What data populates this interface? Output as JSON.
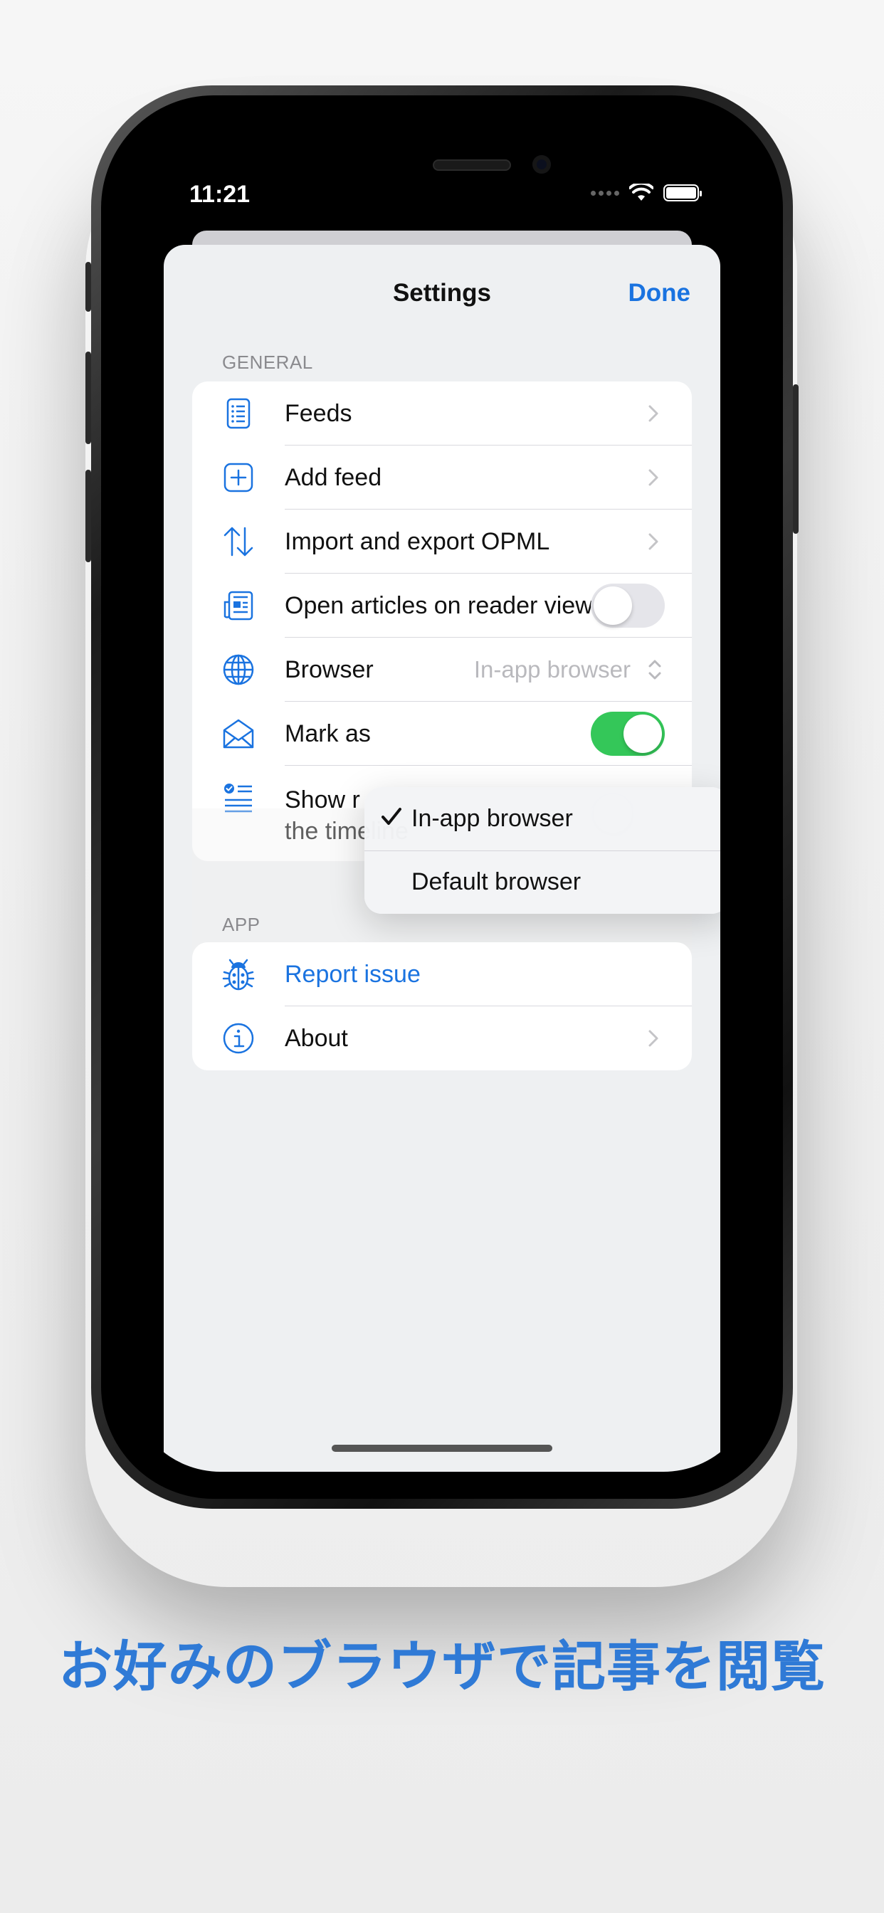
{
  "status_bar": {
    "time": "11:21"
  },
  "nav": {
    "title": "Settings",
    "done_label": "Done"
  },
  "general": {
    "header": "GENERAL",
    "rows": [
      {
        "label": "Feeds",
        "icon": "list-icon",
        "accessory": "chevron"
      },
      {
        "label": "Add feed",
        "icon": "plus-square-icon",
        "accessory": "chevron"
      },
      {
        "label": "Import and export OPML",
        "icon": "arrows-up-down-icon",
        "accessory": "chevron"
      },
      {
        "label": "Open articles on reader view",
        "icon": "newspaper-icon",
        "accessory": "toggle",
        "toggle_on": false
      },
      {
        "label": "Browser",
        "icon": "globe-icon",
        "accessory": "menu",
        "value": "In-app browser"
      },
      {
        "label": "Mark as",
        "icon": "envelope-open-icon",
        "accessory": "toggle",
        "toggle_on": true
      },
      {
        "label": "Show r",
        "label_line2": "the timeline",
        "icon": "checklist-icon",
        "accessory": "toggle",
        "toggle_on": false
      }
    ]
  },
  "browser_menu": {
    "options": [
      {
        "label": "In-app browser",
        "selected": true
      },
      {
        "label": "Default browser",
        "selected": false
      }
    ]
  },
  "app": {
    "header": "APP",
    "rows": [
      {
        "label": "Report issue",
        "icon": "ladybug-icon",
        "accessory": "none",
        "color": "#1a73e0"
      },
      {
        "label": "About",
        "icon": "info-circle-icon",
        "accessory": "chevron"
      }
    ]
  },
  "caption": "お好みのブラウザで記事を閲覧",
  "colors": {
    "accent": "#1a73e0",
    "caption": "#2f7ad6",
    "toggle_on": "#34c759",
    "sheet_bg": "#eef0f2"
  }
}
